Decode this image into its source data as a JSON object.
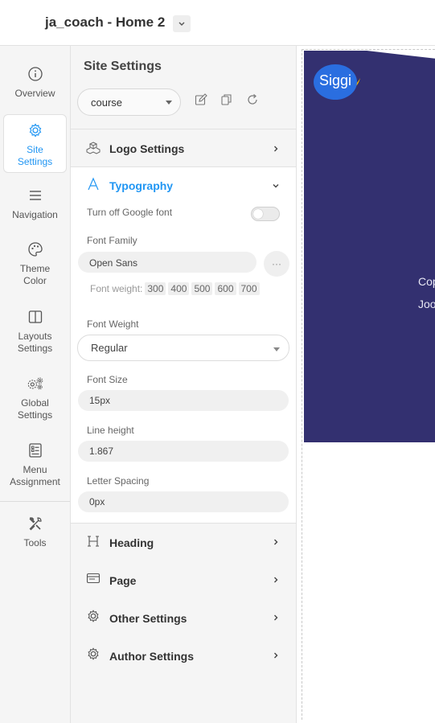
{
  "header": {
    "site_title": "ja_coach - Home 2"
  },
  "rail": {
    "items": [
      {
        "label": "Overview",
        "icon": "info-icon"
      },
      {
        "label": "Site Settings",
        "icon": "gear-icon",
        "active": true
      },
      {
        "label": "Navigation",
        "icon": "menu-icon"
      },
      {
        "label": "Theme Color",
        "icon": "palette-icon"
      },
      {
        "label": "Layouts Settings",
        "icon": "layout-icon"
      },
      {
        "label": "Global Settings",
        "icon": "gears-icon"
      },
      {
        "label": "Menu Assignment",
        "icon": "list-icon"
      },
      {
        "label": "Tools",
        "icon": "tools-icon"
      }
    ]
  },
  "panel": {
    "title": "Site Settings",
    "preset_value": "course",
    "sections": {
      "logo": "Logo Settings",
      "typography": "Typography",
      "heading": "Heading",
      "page": "Page",
      "other": "Other Settings",
      "author": "Author Settings"
    },
    "typography": {
      "google_font_label": "Turn off Google font",
      "google_font_off": false,
      "font_family_label": "Font Family",
      "font_family_value": "Open Sans",
      "font_weight_caption": "Font weight:",
      "font_weights": [
        "300",
        "400",
        "500",
        "600",
        "700"
      ],
      "font_weight_label": "Font Weight",
      "font_weight_value": "Regular",
      "font_size_label": "Font Size",
      "font_size_value": "15px",
      "line_height_label": "Line height",
      "line_height_value": "1.867",
      "letter_spacing_label": "Letter Spacing",
      "letter_spacing_value": "0px"
    }
  },
  "preview": {
    "logo_text": "Siggi",
    "text_line1": "Cop",
    "text_line2": "Joo",
    "hero_color": "#333070",
    "accent_color": "#2196f3"
  }
}
